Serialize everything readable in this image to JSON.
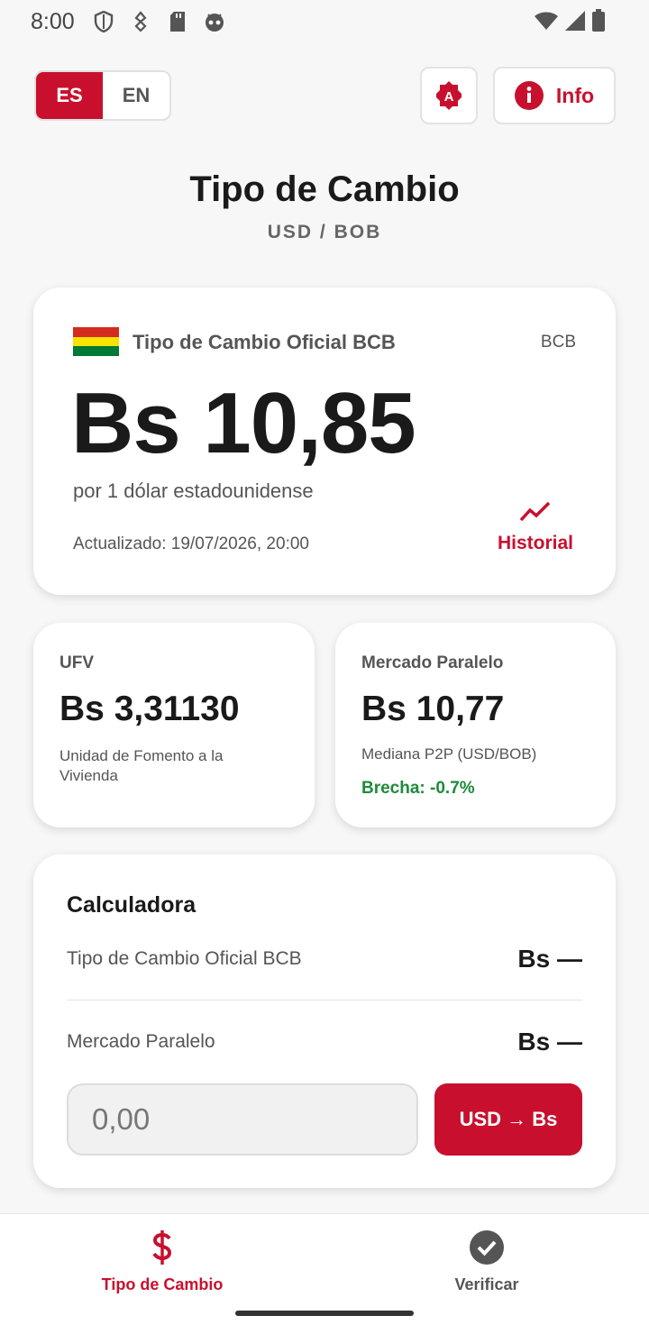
{
  "status_bar": {
    "time": "8:00",
    "left_icons": [
      "shield-icon",
      "usb-debug-icon",
      "sd-card-icon",
      "android-head-icon"
    ],
    "right_icons": [
      "wifi-icon",
      "signal-icon",
      "battery-icon"
    ]
  },
  "language": {
    "es_label": "ES",
    "en_label": "EN",
    "selected": "ES"
  },
  "info_button": {
    "label": "Info"
  },
  "header": {
    "title": "Tipo de Cambio",
    "subtitle": "USD / BOB"
  },
  "official": {
    "label": "Tipo de Cambio Oficial BCB",
    "tag": "BCB",
    "value": "Bs 10,85",
    "description": "por 1 dólar estadounidense",
    "updated": "Actualizado: 19/07/2026, 20:00",
    "history_label": "Historial"
  },
  "ufv": {
    "label": "UFV",
    "value": "Bs 3,31130",
    "description": "Unidad de Fomento a la Vivienda"
  },
  "parallel": {
    "label": "Mercado Paralelo",
    "value": "Bs 10,77",
    "description": "Mediana P2P (USD/BOB)",
    "gap": "Brecha: -0.7%"
  },
  "calculator": {
    "title": "Calculadora",
    "rows": [
      {
        "label": "Tipo de Cambio Oficial BCB",
        "value": "Bs —"
      },
      {
        "label": "Mercado Paralelo",
        "value": "Bs —"
      }
    ],
    "input_placeholder": "0,00",
    "convert_label": "USD → Bs"
  },
  "bottom_nav": {
    "items": [
      {
        "label": "Tipo de Cambio",
        "icon": "dollar-icon",
        "active": true
      },
      {
        "label": "Verificar",
        "icon": "check-circle-icon",
        "active": false
      }
    ]
  },
  "colors": {
    "accent": "#c8102e",
    "positive": "#1e8b3a",
    "background": "#f7f7f7"
  }
}
